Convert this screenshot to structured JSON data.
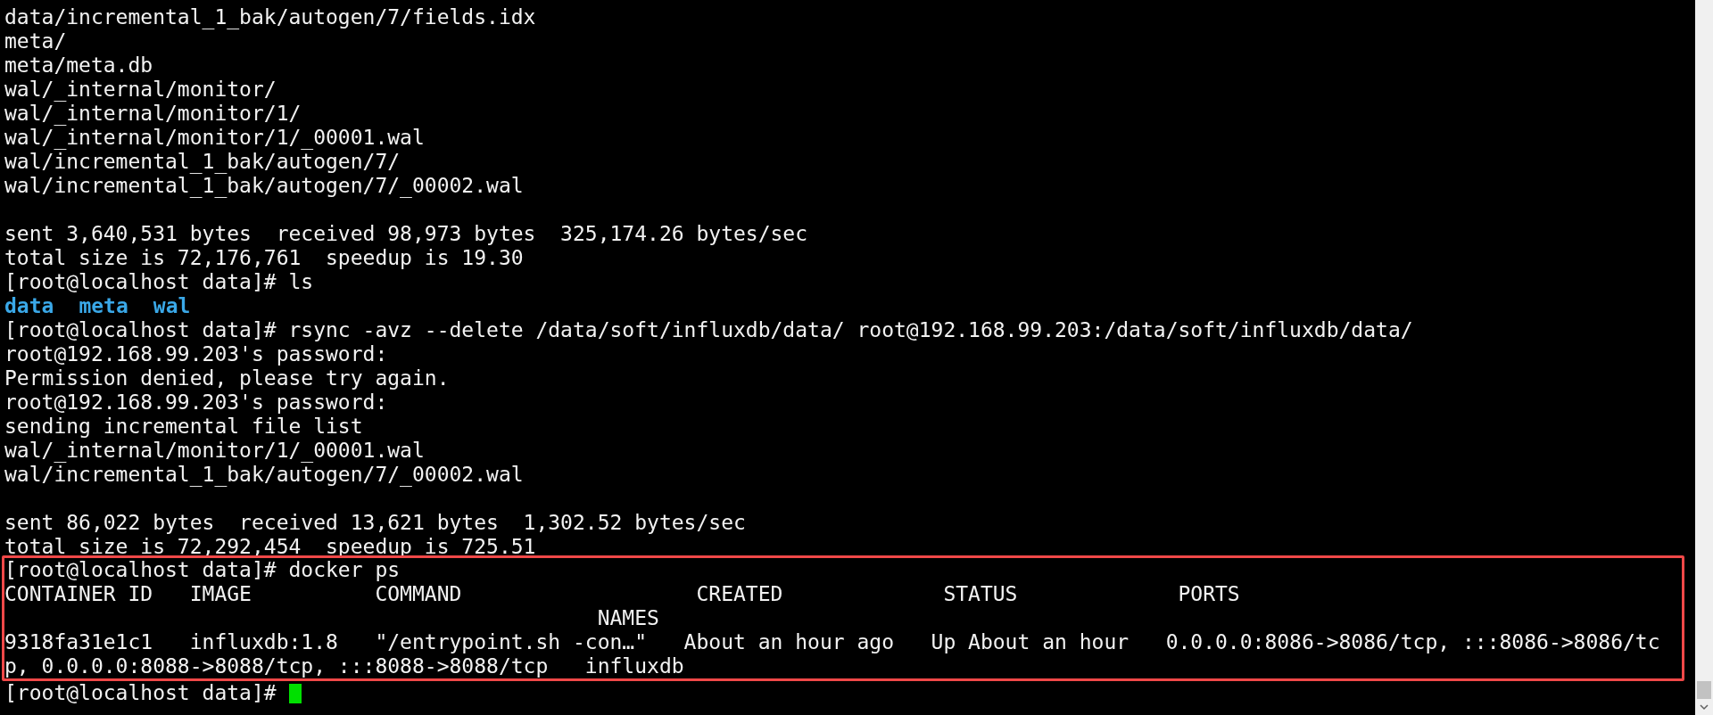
{
  "terminal": {
    "lines": [
      {
        "kind": "output",
        "text": "data/incremental_1_bak/autogen/7/fields.idx"
      },
      {
        "kind": "output",
        "text": "meta/"
      },
      {
        "kind": "output",
        "text": "meta/meta.db"
      },
      {
        "kind": "output",
        "text": "wal/_internal/monitor/"
      },
      {
        "kind": "output",
        "text": "wal/_internal/monitor/1/"
      },
      {
        "kind": "output",
        "text": "wal/_internal/monitor/1/_00001.wal"
      },
      {
        "kind": "output",
        "text": "wal/incremental_1_bak/autogen/7/"
      },
      {
        "kind": "output",
        "text": "wal/incremental_1_bak/autogen/7/_00002.wal"
      },
      {
        "kind": "blank"
      },
      {
        "kind": "output",
        "text": "sent 3,640,531 bytes  received 98,973 bytes  325,174.26 bytes/sec"
      },
      {
        "kind": "output",
        "text": "total size is 72,176,761  speedup is 19.30"
      },
      {
        "kind": "output",
        "text": "[root@localhost data]# ls"
      },
      {
        "kind": "listing",
        "items": [
          "data",
          "meta",
          "wal"
        ]
      },
      {
        "kind": "output",
        "text": "[root@localhost data]# rsync -avz --delete /data/soft/influxdb/data/ root@192.168.99.203:/data/soft/influxdb/data/"
      },
      {
        "kind": "output",
        "text": "root@192.168.99.203's password:"
      },
      {
        "kind": "output",
        "text": "Permission denied, please try again."
      },
      {
        "kind": "output",
        "text": "root@192.168.99.203's password:"
      },
      {
        "kind": "output",
        "text": "sending incremental file list"
      },
      {
        "kind": "output",
        "text": "wal/_internal/monitor/1/_00001.wal"
      },
      {
        "kind": "output",
        "text": "wal/incremental_1_bak/autogen/7/_00002.wal"
      },
      {
        "kind": "blank"
      },
      {
        "kind": "output",
        "text": "sent 86,022 bytes  received 13,621 bytes  1,302.52 bytes/sec"
      },
      {
        "kind": "output",
        "text": "total size is 72,292,454  speedup is 725.51"
      }
    ],
    "highlighted_block": {
      "lines": [
        {
          "kind": "output",
          "text": "[root@localhost data]# docker ps"
        },
        {
          "kind": "output",
          "text": "CONTAINER ID   IMAGE          COMMAND                   CREATED             STATUS             PORTS"
        },
        {
          "kind": "output",
          "text": "                                                NAMES"
        },
        {
          "kind": "output",
          "text": "9318fa31e1c1   influxdb:1.8   \"/entrypoint.sh -con…\"   About an hour ago   Up About an hour   0.0.0.0:8086->8086/tcp, :::8086->8086/tc"
        },
        {
          "kind": "output",
          "text": "p, 0.0.0.0:8088->8088/tcp, :::8088->8088/tcp   influxdb"
        }
      ]
    },
    "prompt": {
      "text": "[root@localhost data]# ",
      "cursor": true
    }
  }
}
